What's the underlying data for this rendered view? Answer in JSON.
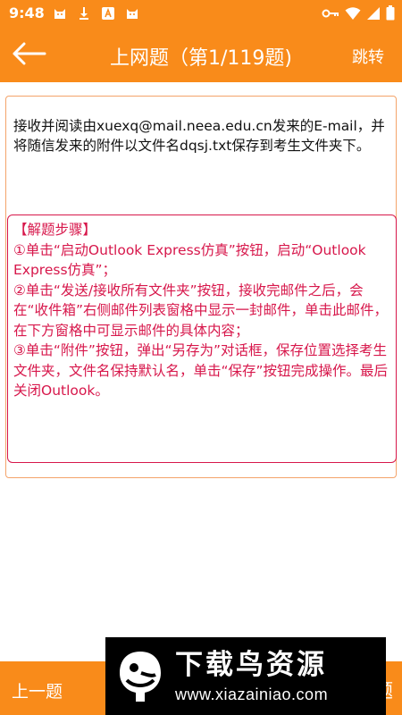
{
  "status_bar": {
    "time": "9:48",
    "accent_color": "#f98b1a",
    "left_icons": [
      "cat-icon",
      "download-icon",
      "a-app-icon",
      "cat-icon"
    ],
    "right_icons": [
      "key-icon",
      "wifi-icon",
      "signal-icon",
      "battery-icon"
    ]
  },
  "app_bar": {
    "back_icon": "arrow-left-icon",
    "title": "上网题（第1/119题)",
    "jump_label": "跳转"
  },
  "question": {
    "text": "接收并阅读由xuexq@mail.neea.edu.cn发来的E-mail，并将随信发来的附件以文件名dqsj.txt保存到考生文件夹下。"
  },
  "solution": {
    "header": "【解题步骤】",
    "steps": [
      "①单击“启动Outlook Express仿真”按钮，启动“Outlook Express仿真”；",
      "②单击“发送/接收所有文件夹”按钮，接收完邮件之后，会在“收件箱”右侧邮件列表窗格中显示一封邮件，单击此邮件，在下方窗格中可显示邮件的具体内容；",
      "③单击“附件”按钮，弹出“另存为”对话框，保存位置选择考生文件夹，文件名保持默认名，单击“保存”按钮完成操作。最后关闭Outlook。"
    ],
    "color": "#d7174b"
  },
  "bottom_bar": {
    "prev_label": "上一题",
    "next_partial": "题"
  },
  "watermark": {
    "title": "下载鸟资源",
    "url": "www.xiazainiao.com"
  }
}
